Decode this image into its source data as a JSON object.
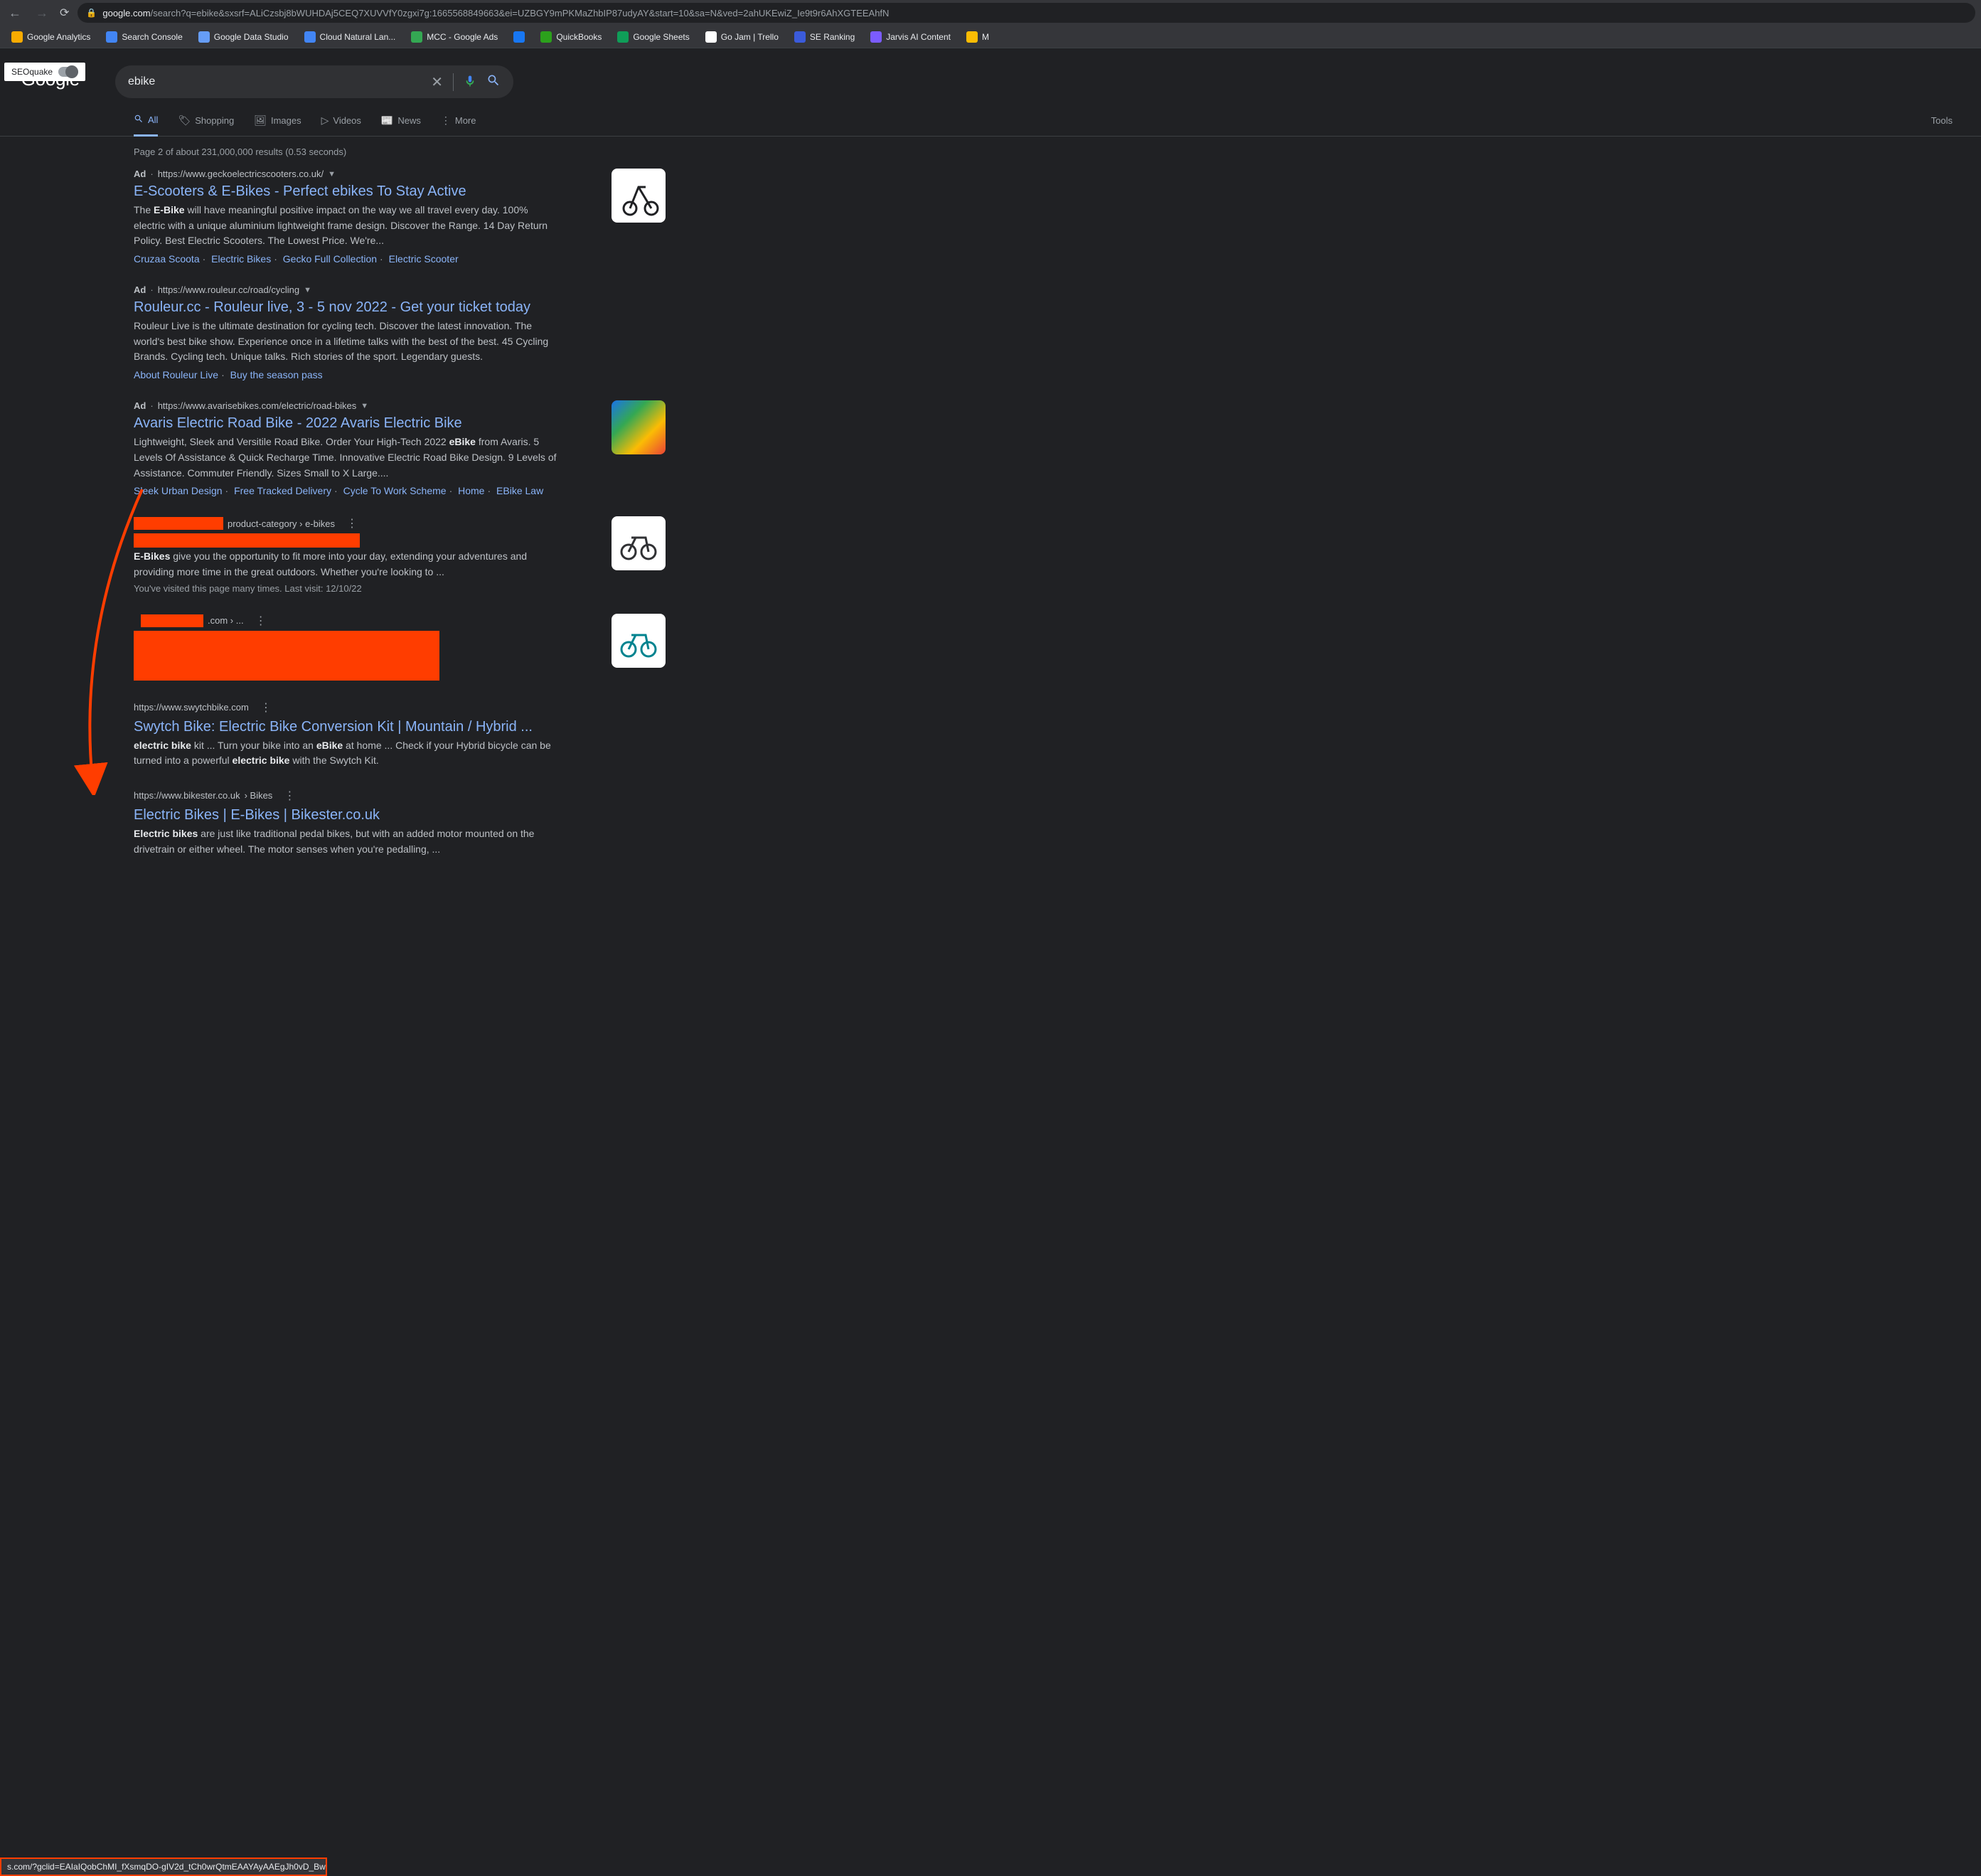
{
  "browser": {
    "url_prefix": "google.com",
    "url_path": "/search?q=ebike&sxsrf=ALiCzsbj8bWUHDAj5CEQ7XUVVfY0zgxi7g:1665568849663&ei=UZBGY9mPKMaZhbIP87udyAY&start=10&sa=N&ved=2ahUKEwiZ_Ie9t9r6AhXGTEEAhfN"
  },
  "bookmarks": [
    {
      "label": "Google Analytics",
      "color": "#f9ab00"
    },
    {
      "label": "Search Console",
      "color": "#4285f4"
    },
    {
      "label": "Google Data Studio",
      "color": "#669df6"
    },
    {
      "label": "Cloud Natural Lan...",
      "color": "#4285f4"
    },
    {
      "label": "MCC - Google Ads",
      "color": "#34a853"
    },
    {
      "label": "",
      "color": "#1877f2"
    },
    {
      "label": "QuickBooks",
      "color": "#2ca01c"
    },
    {
      "label": "Google Sheets",
      "color": "#0f9d58"
    },
    {
      "label": "Go Jam | Trello",
      "color": "#fff"
    },
    {
      "label": "SE Ranking",
      "color": "#3b5bdb"
    },
    {
      "label": "Jarvis AI Content",
      "color": "#7b5cff"
    },
    {
      "label": "M",
      "color": "#fbbc04"
    }
  ],
  "seoquake": {
    "label": "SEOquake"
  },
  "search": {
    "query": "ebike"
  },
  "tabs": {
    "all": "All",
    "shopping": "Shopping",
    "images": "Images",
    "videos": "Videos",
    "news": "News",
    "more": "More",
    "tools": "Tools"
  },
  "stats": "Page 2 of about 231,000,000 results (0.53 seconds)",
  "ad_label": "Ad",
  "results": [
    {
      "is_ad": true,
      "cite": "https://www.geckoelectricscooters.co.uk/",
      "title": "E-Scooters & E-Bikes - Perfect ebikes To Stay Active",
      "desc_pre": "The ",
      "desc_bold1": "E-Bike",
      "desc_post": " will have meaningful positive impact on the way we all travel every day. 100% electric with a unique aluminium lightweight frame design. Discover the Range. 14 Day Return Policy. Best Electric Scooters. The Lowest Price. We're...",
      "sitelinks": [
        "Cruzaa Scoota",
        "Electric Bikes",
        "Gecko Full Collection",
        "Electric Scooter"
      ],
      "thumb": "scooter"
    },
    {
      "is_ad": true,
      "cite": "https://www.rouleur.cc/road/cycling",
      "title": "Rouleur.cc - Rouleur live, 3 - 5 nov 2022 - Get your ticket today",
      "desc_plain": "Rouleur Live is the ultimate destination for cycling tech. Discover the latest innovation. The world's best bike show. Experience once in a lifetime talks with the best of the best. 45 Cycling Brands. Cycling tech. Unique talks. Rich stories of the sport. Legendary guests.",
      "sitelinks": [
        "About Rouleur Live",
        "Buy the season pass"
      ]
    },
    {
      "is_ad": true,
      "cite": "https://www.avarisebikes.com/electric/road-bikes",
      "title": "Avaris Electric Road Bike - 2022 Avaris Electric Bike",
      "desc_pre": "Lightweight, Sleek and Versitile Road Bike. Order Your High-Tech 2022 ",
      "desc_bold1": "eBike",
      "desc_post": " from Avaris. 5 Levels Of Assistance & Quick Recharge Time. Innovative Electric Road Bike Design. 9 Levels of Assistance. Commuter Friendly. Sizes Small to X Large....",
      "sitelinks": [
        "Sleek Urban Design",
        "Free Tracked Delivery",
        "Cycle To Work Scheme",
        "Home",
        "EBike Law"
      ],
      "thumb": "colorful"
    },
    {
      "redacted_cite_suffix": "product-category › e-bikes",
      "desc_bold_start": "E-Bikes",
      "desc_rest": " give you the opportunity to fit more into your day, extending your adventures and providing more time in the great outdoors. Whether you're looking to ...",
      "visited_note": "You've visited this page many times. Last visit: 12/10/22",
      "thumb": "bike-dark"
    },
    {
      "redacted_cite_suffix": ".com › ...",
      "thumb": "bike-teal"
    },
    {
      "cite": "https://www.swytchbike.com",
      "title": "Swytch Bike: Electric Bike Conversion Kit | Mountain / Hybrid ...",
      "desc_html": "electric bike kit ... Turn your bike into an eBike at home ... Check if your Hybrid bicycle can be turned into a powerful electric bike with the Swytch Kit."
    },
    {
      "cite": "https://www.bikester.co.uk",
      "cite_crumb": " › Bikes",
      "title": "Electric Bikes | E-Bikes | Bikester.co.uk",
      "desc_html": "Electric bikes are just like traditional pedal bikes, but with an added motor mounted on the drivetrain or either wheel. The motor senses when you're pedalling, ..."
    }
  ],
  "hover_url": "s.com/?gclid=EAIaIQobChMI_fXsmqDO-gIV2d_tCh0wrQtmEAAYAyAAEgJh0vD_Bw"
}
